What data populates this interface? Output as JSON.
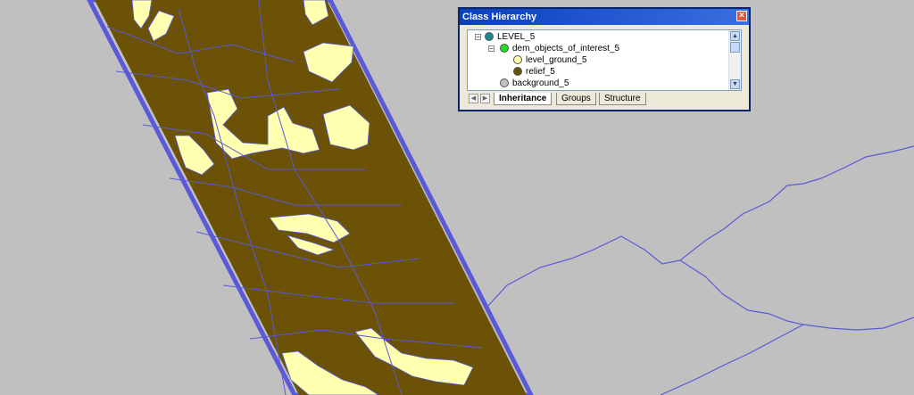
{
  "colors": {
    "background": "#c0c0c0",
    "relief": "#6b5206",
    "level_ground": "#ffffb0",
    "segment_line": "#5a5ad8",
    "titlebar": "#0a3fbe"
  },
  "panel": {
    "title": "Class Hierarchy",
    "close_icon": "close-icon",
    "tree": [
      {
        "label": "LEVEL_5",
        "color": "#1b8a8a",
        "expander": "−"
      },
      {
        "label": "dem_objects_of_interest_5",
        "color": "#22dd22",
        "expander": "−"
      },
      {
        "label": "level_ground_5",
        "color": "#ffffb0"
      },
      {
        "label": "relief_5",
        "color": "#6b5206"
      },
      {
        "label": "background_5",
        "color": "#c0c0c0"
      }
    ],
    "tabs": [
      "Inheritance",
      "Groups",
      "Structure"
    ],
    "active_tab": "Inheritance"
  }
}
